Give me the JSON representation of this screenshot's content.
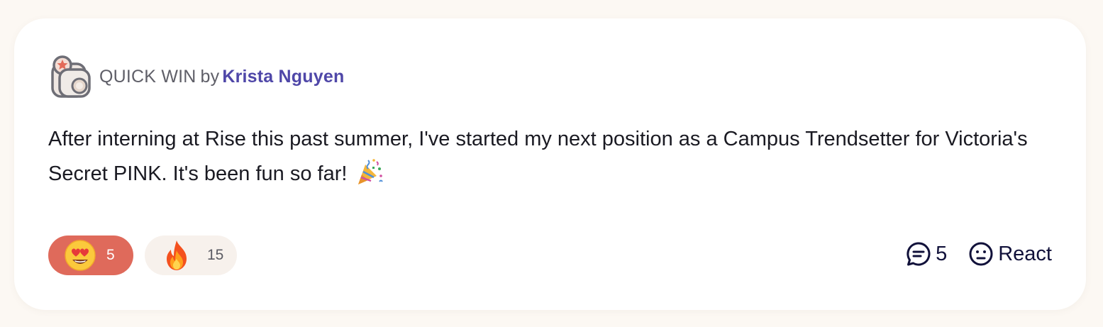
{
  "post": {
    "type_label": "QUICK WIN",
    "by_label": "by",
    "author": "Krista Nguyen",
    "body": "After interning at Rise this past summer, I've started my next position as a Campus Trendsetter for Victoria's Secret PINK. It's been fun so far!",
    "badge_icon": "camera-star-icon",
    "body_emoji": "party-popper-icon"
  },
  "reactions": [
    {
      "icon": "heart-eyes-emoji-icon",
      "count": "5",
      "selected": true,
      "color": "#df6a5b"
    },
    {
      "icon": "fire-emoji-icon",
      "count": "15",
      "selected": false,
      "color": "#f7f1ec"
    }
  ],
  "actions": {
    "comments_count": "5",
    "react_label": "React"
  },
  "colors": {
    "author": "#4f47a8",
    "background": "#fcf8f3",
    "card": "#ffffff",
    "action_text": "#11113a"
  }
}
